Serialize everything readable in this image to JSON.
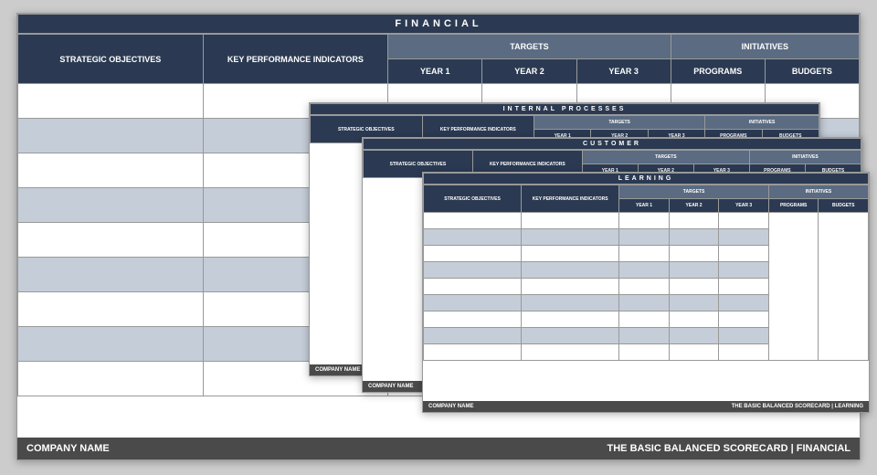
{
  "columns": {
    "strategic": "STRATEGIC OBJECTIVES",
    "kpi": "KEY PERFORMANCE INDICATORS",
    "targets": "TARGETS",
    "year1": "YEAR 1",
    "year2": "YEAR 2",
    "year3": "YEAR 3",
    "initiatives": "INITIATIVES",
    "programs": "PROGRAMS",
    "budgets": "BUDGETS"
  },
  "footer": {
    "company": "COMPANY NAME",
    "title_prefix": "THE BASIC BALANCED SCORECARD | "
  },
  "cards": {
    "financial": "FINANCIAL",
    "internal": "INTERNAL  PROCESSES",
    "customer": "CUSTOMER",
    "learning": "LEARNING"
  }
}
